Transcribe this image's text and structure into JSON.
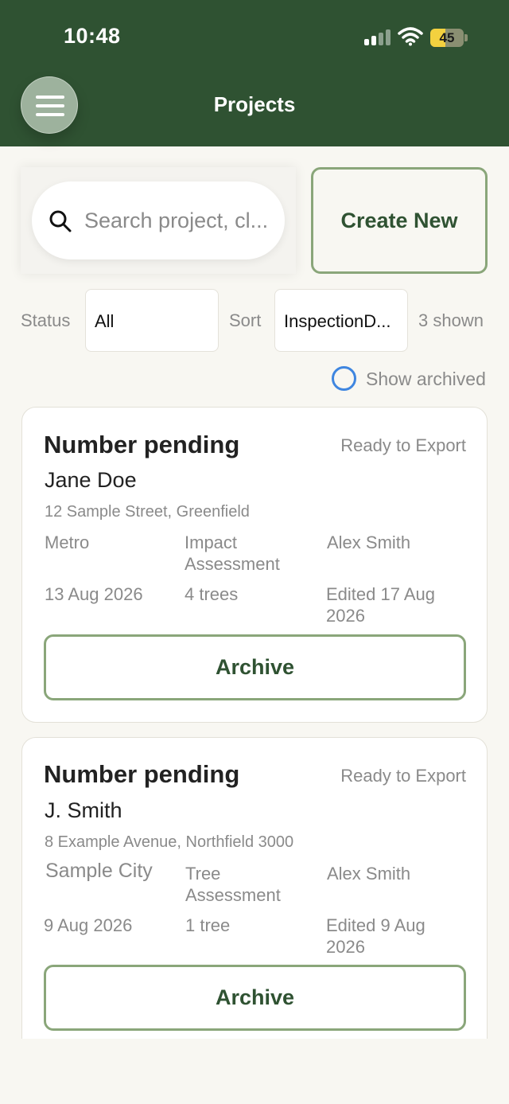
{
  "status_bar": {
    "time": "10:48",
    "battery": "45",
    "battery_level": 0.45
  },
  "header": {
    "title": "Projects"
  },
  "search": {
    "placeholder": "Search project, cl..."
  },
  "create_label": "Create New",
  "filters": {
    "status_label": "Status",
    "status_value": "All",
    "sort_label": "Sort",
    "sort_value": "InspectionD...",
    "shown_count": "3 shown",
    "show_archived_label": "Show archived"
  },
  "projects": [
    {
      "number": "Number pending",
      "status": "Ready to Export",
      "client": "Jane Doe",
      "address": "12 Sample Street, Greenfield",
      "region": "Metro",
      "type": "Impact Assessment",
      "assessor": "Alex Smith",
      "date": "13 Aug 2026",
      "trees": "4 trees",
      "edited": "Edited 17 Aug 2026",
      "archive_label": "Archive"
    },
    {
      "number": "Number pending",
      "status": "Ready to Export",
      "client": "J. Smith",
      "address": "8 Example Avenue, Northfield 3000",
      "region": "Sample City",
      "type": "Tree Assessment",
      "assessor": "Alex Smith",
      "date": "9 Aug 2026",
      "trees": "1 tree",
      "edited": "Edited 9 Aug 2026",
      "archive_label": "Archive"
    }
  ],
  "colors": {
    "header": "#2f5232",
    "accent": "#8aa67a",
    "background": "#f8f7f2",
    "radio": "#3f86e0"
  }
}
